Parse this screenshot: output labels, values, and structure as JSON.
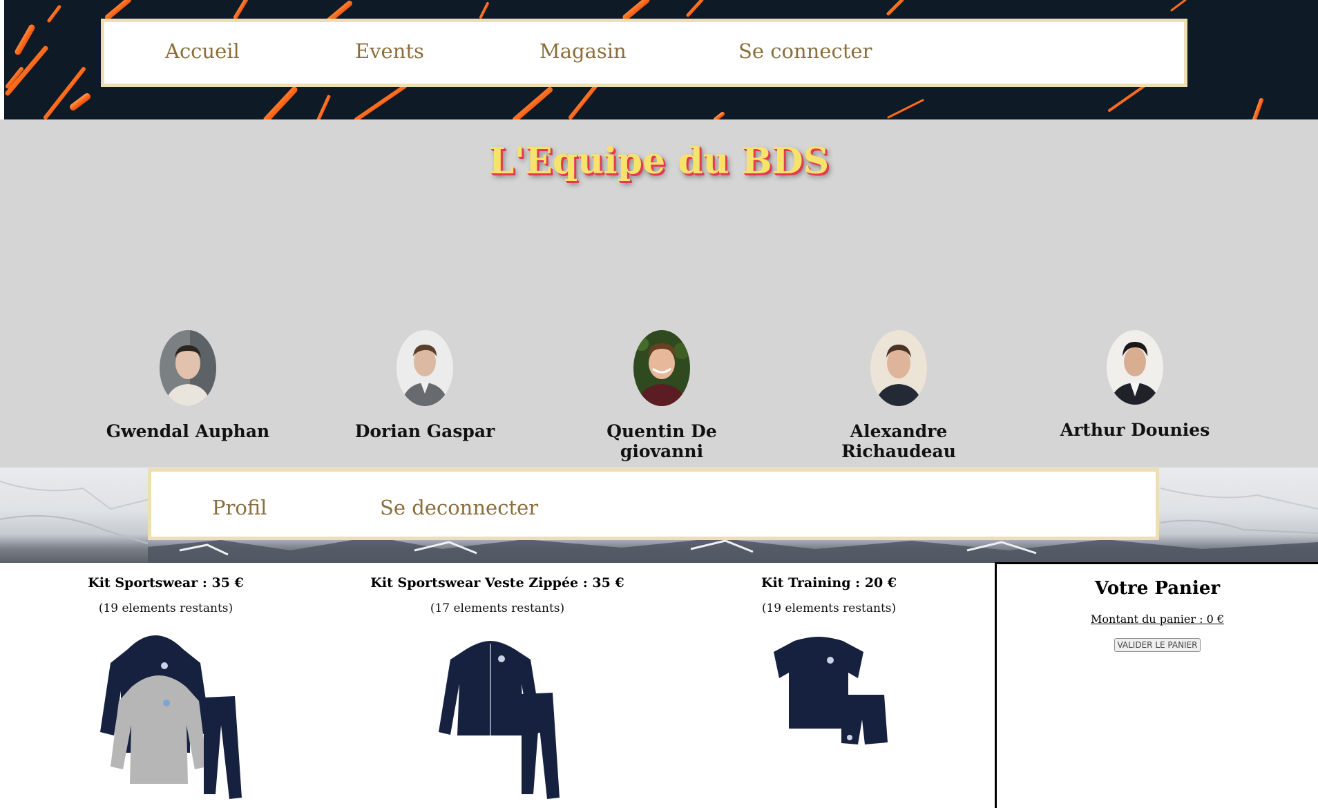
{
  "nav_main": {
    "items": [
      {
        "label": "Accueil"
      },
      {
        "label": "Events"
      },
      {
        "label": "Magasin"
      },
      {
        "label": "Se connecter"
      }
    ]
  },
  "team": {
    "title": "L'Equipe du BDS",
    "members": [
      {
        "name": "Gwendal Auphan"
      },
      {
        "name": "Dorian Gaspar"
      },
      {
        "name": "Quentin De giovanni"
      },
      {
        "name": "Alexandre Richaudeau"
      },
      {
        "name": "Arthur Dounies"
      }
    ]
  },
  "nav_user": {
    "items": [
      {
        "label": "Profil"
      },
      {
        "label": "Se deconnecter"
      }
    ]
  },
  "products": [
    {
      "title": "Kit Sportswear : 35 €",
      "stock": "(19 elements restants)"
    },
    {
      "title": "Kit Sportswear Veste Zippée : 35 €",
      "stock": "(17 elements restants)"
    },
    {
      "title": "Kit Training : 20 €",
      "stock": "(19 elements restants)"
    }
  ],
  "cart": {
    "title": "Votre Panier",
    "amount": "Montant du panier : 0 €",
    "validate_label": "VALIDER LE PANIER"
  },
  "colors": {
    "nav_link": "#8a6d3b",
    "nav_border": "#eedfb3",
    "banner_bg": "#0e1a25",
    "team_bg": "#d5d5d5",
    "title_fill": "#f7e36b",
    "title_shadow": "#e23a55",
    "apparel_navy": "#16213f",
    "apparel_grey": "#b6b6b6"
  }
}
